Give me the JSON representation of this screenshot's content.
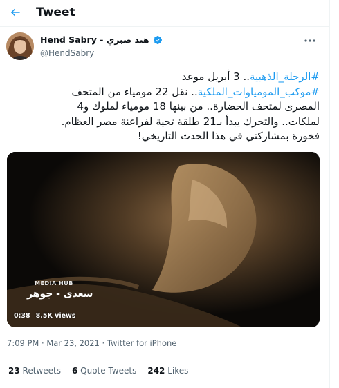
{
  "header": {
    "title": "Tweet",
    "back_icon": "arrow-left-icon"
  },
  "author": {
    "display_name": "Hend Sabry - هند صبري",
    "handle": "@HendSabry",
    "verified_icon": "verified-badge-icon"
  },
  "tweet": {
    "line1_hashtag": "#الرحلة_الذهبية",
    "line1_text": ".. 3 أبريل موعد",
    "line2_hashtag": "#موكب_المومياوات_الملكية",
    "line2_text": ".. نقل 22 مومياء من المتحف",
    "line3": "المصرى لمتحف الحضارة.. من بينها 18 مومياء لملوك و4",
    "line4": "لملكات.. والتحرك يبدأ بـ21 طلقة تحية لفراعنة مصر العظام.",
    "line5": "فخورة بمشاركتي في هذا الحدث التاريخي!"
  },
  "media": {
    "watermark": "MEDIA HUB",
    "caption": "سعدى - جوهر",
    "duration": "0:38",
    "views": "8.5K views"
  },
  "meta": {
    "time": "7:09 PM",
    "separator": "·",
    "date": "Mar 23, 2021",
    "source": "Twitter for iPhone"
  },
  "stats": {
    "retweets_count": "23",
    "retweets_label": "Retweets",
    "quotes_count": "6",
    "quotes_label": "Quote Tweets",
    "likes_count": "242",
    "likes_label": "Likes"
  },
  "colors": {
    "accent": "#1d9bf0",
    "text": "#0f1419",
    "secondary": "#536471"
  }
}
